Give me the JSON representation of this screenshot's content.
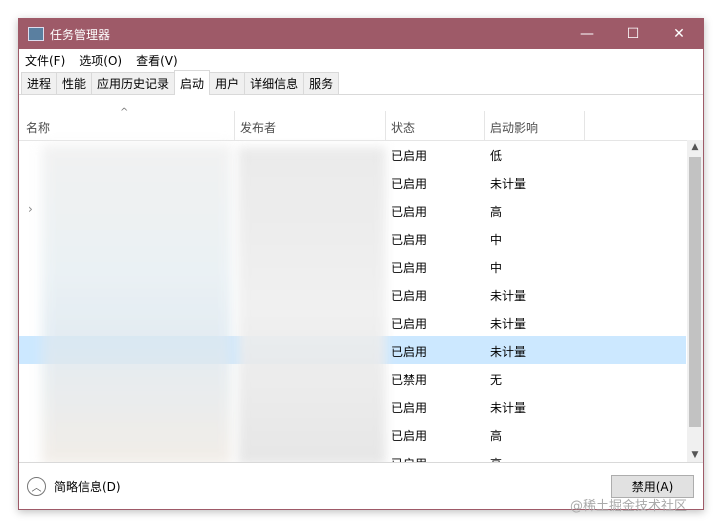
{
  "window": {
    "title": "任务管理器",
    "minimize": "—",
    "maximize": "☐",
    "close": "✕"
  },
  "menu": [
    "文件(F)",
    "选项(O)",
    "查看(V)"
  ],
  "tabs": [
    "进程",
    "性能",
    "应用历史记录",
    "启动",
    "用户",
    "详细信息",
    "服务"
  ],
  "active_tab": "启动",
  "columns": {
    "name": "名称",
    "publisher": "发布者",
    "status": "状态",
    "impact": "启动影响",
    "sort_indicator": "^"
  },
  "rows": [
    {
      "status": "已启用",
      "impact": "低"
    },
    {
      "status": "已启用",
      "impact": "未计量"
    },
    {
      "status": "已启用",
      "impact": "高"
    },
    {
      "status": "已启用",
      "impact": "中"
    },
    {
      "status": "已启用",
      "impact": "中"
    },
    {
      "status": "已启用",
      "impact": "未计量"
    },
    {
      "status": "已启用",
      "impact": "未计量"
    },
    {
      "status": "已启用",
      "impact": "未计量"
    },
    {
      "status": "已禁用",
      "impact": "无"
    },
    {
      "status": "已启用",
      "impact": "未计量"
    },
    {
      "status": "已启用",
      "impact": "高"
    },
    {
      "status": "已启用",
      "impact": "高"
    }
  ],
  "footer": {
    "less_details": "简略信息(D)",
    "disable_button": "禁用(A)"
  },
  "watermark": "@稀土掘金技术社区"
}
